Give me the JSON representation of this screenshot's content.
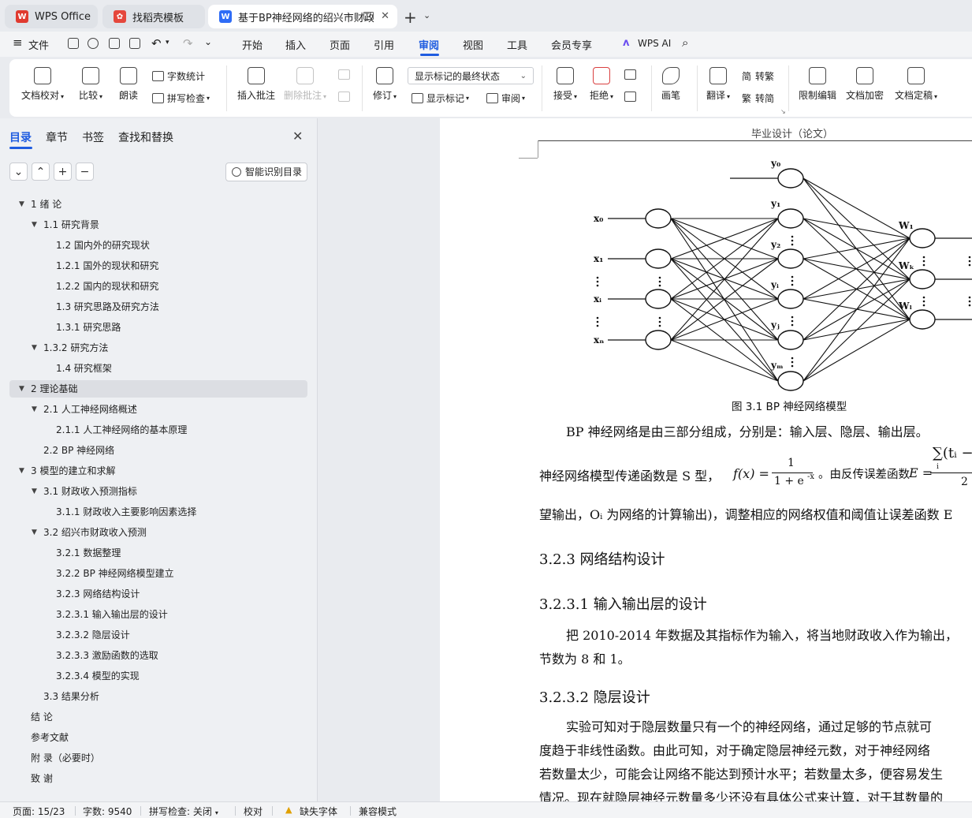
{
  "tabs": {
    "wps_office": "WPS Office",
    "templates": "找稻壳模板",
    "document": "基于BP神经网络的绍兴市财政"
  },
  "menu": {
    "file": "文件",
    "items": [
      "开始",
      "插入",
      "页面",
      "引用",
      "审阅",
      "视图",
      "工具",
      "会员专享"
    ],
    "selected": "审阅",
    "wps_ai": "WPS AI"
  },
  "ribbon": {
    "doc_check": "文档校对",
    "compare": "比较",
    "read_aloud": "朗读",
    "word_count": "字数统计",
    "spell_check": "拼写检查",
    "insert_comment": "插入批注",
    "delete_comment": "删除批注",
    "revise": "修订",
    "markup_select": "显示标记的最终状态",
    "show_markup": "显示标记",
    "review": "审阅",
    "accept": "接受",
    "reject": "拒绝",
    "pen": "画笔",
    "translate": "翻译",
    "to_traditional": "转繁",
    "to_simplified": "转简",
    "traditional_char": "繁",
    "simplified_char": "简",
    "restrict_edit": "限制编辑",
    "doc_encrypt": "文档加密",
    "finalize": "文档定稿"
  },
  "nav": {
    "tabs": [
      "目录",
      "章节",
      "书签",
      "查找和替换"
    ],
    "smart_toc": "智能识别目录",
    "toc": [
      {
        "text": "1  绪  论",
        "level": 0,
        "arrow": true
      },
      {
        "text": "1.1  研究背景",
        "level": 1,
        "arrow": true
      },
      {
        "text": "1.2  国内外的研究现状",
        "level": 2,
        "arrow": false
      },
      {
        "text": "1.2.1 国外的现状和研究",
        "level": 2,
        "arrow": false
      },
      {
        "text": "1.2.2 国内的现状和研究",
        "level": 2,
        "arrow": false
      },
      {
        "text": "1.3 研究思路及研究方法",
        "level": 2,
        "arrow": false
      },
      {
        "text": "1.3.1 研究思路",
        "level": 2,
        "arrow": false
      },
      {
        "text": "1.3.2  研究方法",
        "level": 1,
        "arrow": true
      },
      {
        "text": "1.4  研究框架",
        "level": 2,
        "arrow": false
      },
      {
        "text": "2  理论基础",
        "level": 0,
        "arrow": true,
        "selected": true
      },
      {
        "text": "2.1  人工神经网络概述",
        "level": 1,
        "arrow": true
      },
      {
        "text": "2.1.1  人工神经网络的基本原理",
        "level": 2,
        "arrow": false
      },
      {
        "text": "2.2 BP 神经网络",
        "level": 1,
        "arrow": false
      },
      {
        "text": "3  模型的建立和求解",
        "level": 0,
        "arrow": true
      },
      {
        "text": "3.1 财政收入预测指标",
        "level": 1,
        "arrow": true
      },
      {
        "text": "3.1.1 财政收入主要影响因素选择",
        "level": 2,
        "arrow": false
      },
      {
        "text": "3.2 绍兴市财政收入预测",
        "level": 1,
        "arrow": true
      },
      {
        "text": "3.2.1 数据整理",
        "level": 2,
        "arrow": false
      },
      {
        "text": "3.2.2 BP 神经网络模型建立",
        "level": 2,
        "arrow": false
      },
      {
        "text": "3.2.3 网络结构设计",
        "level": 2,
        "arrow": false
      },
      {
        "text": "3.2.3.1 输入输出层的设计",
        "level": 2,
        "arrow": false
      },
      {
        "text": "3.2.3.2 隐层设计",
        "level": 2,
        "arrow": false
      },
      {
        "text": "3.2.3.3  激励函数的选取",
        "level": 2,
        "arrow": false
      },
      {
        "text": "3.2.3.4  模型的实现",
        "level": 2,
        "arrow": false
      },
      {
        "text": "3.3 结果分析",
        "level": 1,
        "arrow": false
      },
      {
        "text": "结  论",
        "level": 0,
        "arrow": false
      },
      {
        "text": "参考文献",
        "level": 0,
        "arrow": false
      },
      {
        "text": "附  录（必要时）",
        "level": 0,
        "arrow": false
      },
      {
        "text": "致  谢",
        "level": 0,
        "arrow": false
      }
    ]
  },
  "document": {
    "header": "毕业设计（论文）",
    "figure_caption": "图 3.1 BP 神经网络模型",
    "diagram": {
      "inputs": [
        "x₀",
        "x₁",
        "xᵢ",
        "xₙ"
      ],
      "hidden": [
        "y₀",
        "y₁",
        "y₂",
        "yᵢ",
        "yⱼ",
        "yₘ"
      ],
      "outputs": [
        "W₁",
        "Wₖ",
        "Wₗ"
      ]
    },
    "para1": "BP 神经网络是由三部分组成，分别是：输入层、隐层、输出层。",
    "para2_a": "神经网络模型传递函数是 S 型，",
    "formula_f": "f(x) =",
    "formula_num": "1",
    "formula_den": "1 + e",
    "formula_exp": "-x",
    "para2_b": "。由反传误差函数",
    "formula_E": "E =",
    "formula_sum": "∑(tᵢ −",
    "formula_sum_sub": "i",
    "formula_two": "2",
    "para3": "望输出，Oᵢ 为网络的计算输出)，调整相应的网络权值和阈值让误差函数 E",
    "h1": "3.2.3 网络结构设计",
    "h2": "3.2.3.1 输入输出层的设计",
    "para4": "把 2010-2014 年数据及其指标作为输入，将当地财政收入作为输出，",
    "para5": "节数为 8 和 1。",
    "h3": "3.2.3.2 隐层设计",
    "para6": "实验可知对于隐层数量只有一个的神经网络，通过足够的节点就可",
    "para7": "度趋于非线性函数。由此可知，对于确定隐层神经元数，对于神经网络",
    "para8": "若数量太少，可能会让网络不能达到预计水平；若数量太多，便容易发生",
    "para9": "情况。现在就隐层神经元数量多少还没有具体公式来计算，对于其数量的"
  },
  "status": {
    "page": "页面: 15/23",
    "words": "字数: 9540",
    "spell": "拼写检查: 关闭",
    "proof": "校对",
    "missing_font": "缺失字体",
    "compat": "兼容模式"
  }
}
